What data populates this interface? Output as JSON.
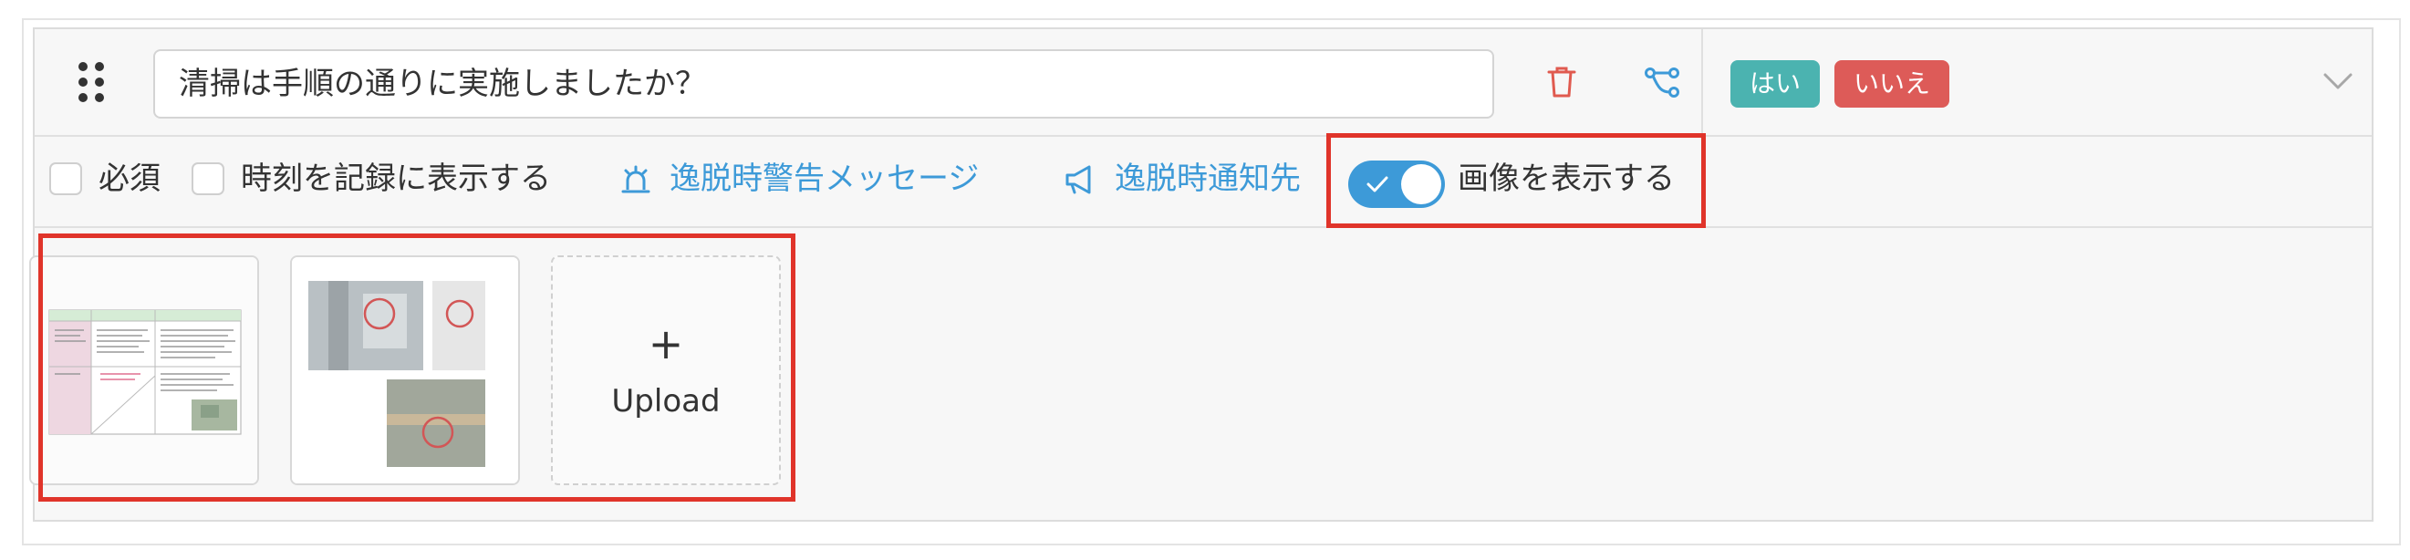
{
  "question": {
    "text": "清掃は手順の通りに実施しましたか？"
  },
  "answers": {
    "yes_label": "はい",
    "no_label": "いいえ",
    "yes_color": "#4bb3b0",
    "no_color": "#dd5b58"
  },
  "options": {
    "required_label": "必須",
    "record_time_label": "時刻を記録に表示する",
    "deviation_warning_label": "逸脱時警告メッセージ",
    "deviation_notify_label": "逸脱時通知先",
    "show_image_label": "画像を表示する",
    "show_image_enabled": true,
    "required_checked": false,
    "record_time_checked": false
  },
  "images": {
    "upload_label": "Upload",
    "upload_plus": "+"
  },
  "colors": {
    "accent": "#3d9ad8",
    "delete": "#e05a4f",
    "highlight": "#e0342a"
  }
}
